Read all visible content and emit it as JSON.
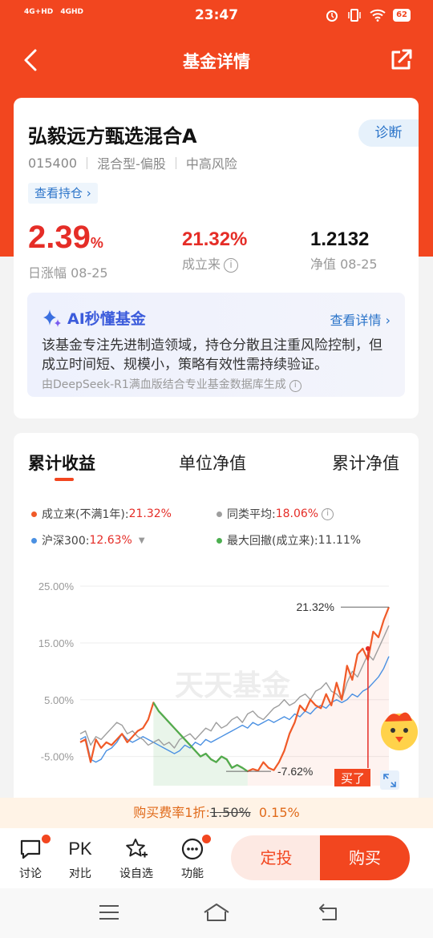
{
  "status_bar": {
    "network_left": "4G+HD",
    "network_right": "4GHD",
    "time": "23:47",
    "battery": "62"
  },
  "header": {
    "title": "基金详情"
  },
  "fund": {
    "name": "弘毅远方甄选混合A",
    "diagnose_label": "诊断",
    "code": "015400",
    "type": "混合型-偏股",
    "risk": "中高风险",
    "holdings_link": "查看持仓 ›",
    "daily_change_value": "2.39",
    "daily_change_unit": "%",
    "daily_change_label": "日涨幅 08-25",
    "since_inception_value": "21.32%",
    "since_inception_label": "成立来",
    "nav_value": "1.2132",
    "nav_label": "净值 08-25"
  },
  "ai": {
    "title": "AI秒懂基金",
    "more_label": "查看详情",
    "summary": "该基金专注先进制造领域，持仓分散且注重风险控制，但成立时间短、规模小，策略有效性需持续验证。",
    "source": "由DeepSeek-R1满血版结合专业基金数据库生成"
  },
  "chart_tabs": [
    "累计收益",
    "单位净值",
    "累计净值"
  ],
  "legend": {
    "fund_label": "成立来(不满1年):",
    "fund_value": "21.32%",
    "peer_label": "同类平均:",
    "peer_value": "18.06%",
    "index_label": "沪深300:",
    "index_value": "12.63%",
    "drawdown_label": "最大回撤(成立来):",
    "drawdown_value": "11.11%"
  },
  "colors": {
    "brand": "#f2461f",
    "fund_line": "#f05a28",
    "peer_line": "#9e9e9e",
    "index_line": "#4a90e2",
    "drawdown": "#4caf50"
  },
  "chart_data": {
    "type": "line",
    "y_ticks": [
      "25.00%",
      "15.00%",
      "5.00%",
      "-5.00%"
    ],
    "ylim": [
      -10,
      27
    ],
    "x_count": 60,
    "series": [
      {
        "name": "成立来(不满1年)",
        "values": [
          -2.5,
          -2.0,
          -6.0,
          -2.0,
          -3.5,
          -2.5,
          -3.0,
          -2.0,
          -1.0,
          -2.5,
          -1.5,
          -0.5,
          0,
          1.5,
          4.5,
          3.0,
          2.0,
          1.0,
          0,
          -1.0,
          -2.0,
          -3.0,
          -4.0,
          -5.0,
          -4.5,
          -5.5,
          -6.0,
          -5.0,
          -5.5,
          -7.0,
          -6.5,
          -7.0,
          -7.62,
          -7.2,
          -7.5,
          -6.0,
          -7.0,
          -7.4,
          -6.0,
          -4.0,
          -1.0,
          1.0,
          4.0,
          3.0,
          5.0,
          4.0,
          3.5,
          6.0,
          4.0,
          8.0,
          5.0,
          11.0,
          8.5,
          13.0,
          14.0,
          12.0,
          17.0,
          16.0,
          19.0,
          21.32
        ]
      },
      {
        "name": "同类平均",
        "values": [
          -1.0,
          -0.5,
          -3.0,
          -1.5,
          -2.0,
          -1.0,
          0,
          1.0,
          0.5,
          -1.0,
          -0.5,
          -1.5,
          -2.0,
          -3.0,
          -2.5,
          -2.0,
          -3.0,
          -2.5,
          -3.5,
          -2.0,
          -1.5,
          -1.0,
          -2.0,
          -1.0,
          0,
          -0.5,
          1.0,
          0,
          0.5,
          1.5,
          2.0,
          1.0,
          2.5,
          3.0,
          2.0,
          1.5,
          2.5,
          3.5,
          4.0,
          5.0,
          4.0,
          4.5,
          5.5,
          6.0,
          5.0,
          6.5,
          7.0,
          8.0,
          6.5,
          6.0,
          5.0,
          8.0,
          10.0,
          9.0,
          11.0,
          13.0,
          12.0,
          14.0,
          16.0,
          18.06
        ]
      },
      {
        "name": "沪深300",
        "values": [
          -2.0,
          -1.5,
          -5.5,
          -6.0,
          -5.5,
          -4.0,
          -3.5,
          -2.5,
          -1.0,
          -2.0,
          -2.5,
          -2.0,
          -1.5,
          -2.0,
          -2.5,
          -3.0,
          -3.5,
          -4.0,
          -4.5,
          -4.0,
          -3.0,
          -3.5,
          -2.5,
          -3.0,
          -2.0,
          -2.5,
          -2.0,
          -1.5,
          -1.0,
          -0.5,
          0,
          0.5,
          0,
          1.0,
          0.5,
          1.0,
          1.5,
          1.0,
          1.5,
          2.0,
          1.5,
          2.5,
          2.0,
          3.0,
          2.5,
          3.5,
          4.0,
          3.5,
          4.5,
          5.0,
          4.5,
          5.0,
          6.0,
          5.5,
          6.5,
          7.0,
          8.0,
          9.0,
          10.5,
          12.63
        ]
      }
    ],
    "drawdown_range": [
      14,
      32
    ],
    "annotations": {
      "max_label": "21.32%",
      "min_label": "-7.62%",
      "buy_label": "买了"
    },
    "watermark": "天天基金"
  },
  "fee": {
    "prefix": "购买费率1折:",
    "original": "1.50%",
    "discounted": "0.15%"
  },
  "bottom_tools": [
    {
      "label": "讨论",
      "icon": "chat-icon"
    },
    {
      "label": "对比",
      "icon": "pk-icon",
      "glyph": "PK"
    },
    {
      "label": "设自选",
      "icon": "star-add-icon"
    },
    {
      "label": "功能",
      "icon": "more-icon"
    }
  ],
  "actions": {
    "dingtou": "定投",
    "buy": "购买"
  }
}
